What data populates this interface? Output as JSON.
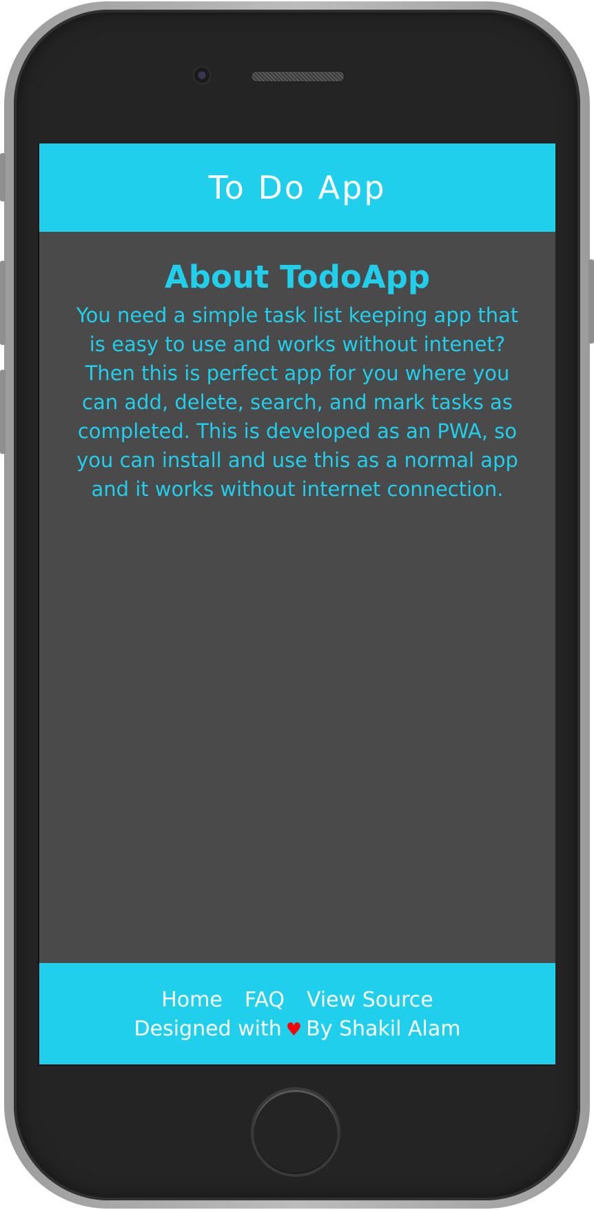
{
  "header": {
    "title": "To Do App"
  },
  "about": {
    "heading": "About TodoApp",
    "text": "You need a simple task list keeping app that is easy to use and works without intenet? Then this is perfect app for you where you can add, delete, search, and mark tasks as completed. This is developed as an PWA, so you can install and use this as a normal app and it works without internet connection."
  },
  "footer": {
    "links": [
      "Home",
      "FAQ",
      "View Source"
    ],
    "credit_prefix": "Designed with",
    "credit_suffix": "By Shakil Alam"
  },
  "colors": {
    "accent": "#20cfec",
    "background": "#4a4a4a",
    "heart": "#ff0000"
  },
  "icons": [
    "heart-icon"
  ]
}
